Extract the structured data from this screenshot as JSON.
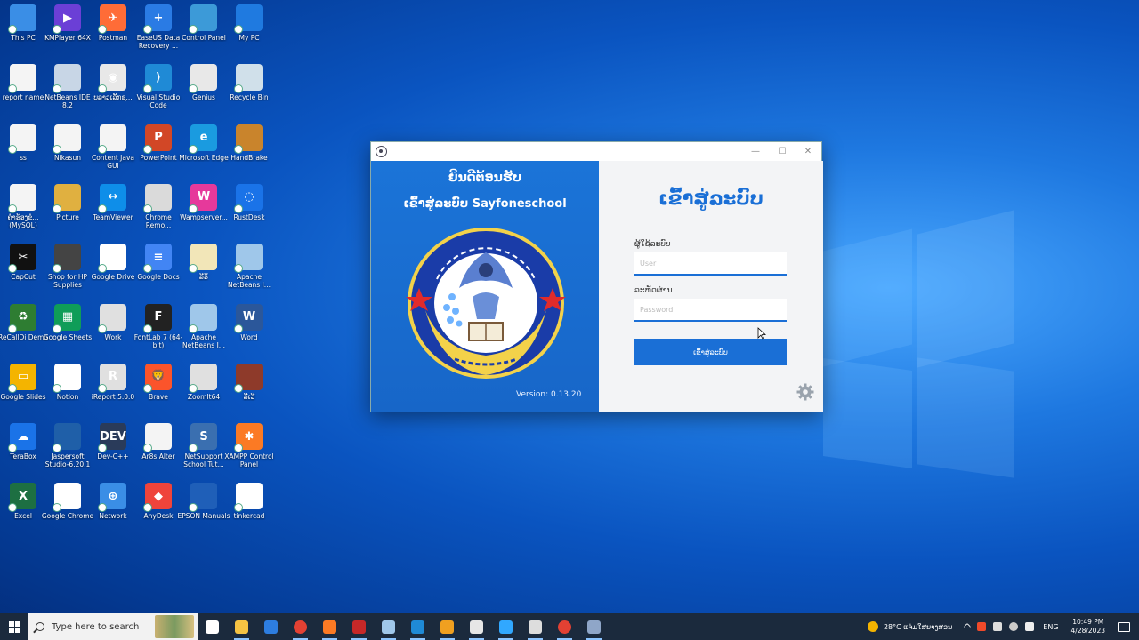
{
  "desktop": {
    "icons": [
      {
        "label": "This PC",
        "color": "#3a8ee6",
        "glyph": ""
      },
      {
        "label": "KMPlayer 64X",
        "color": "#6b3fd6",
        "glyph": "▶"
      },
      {
        "label": "Postman",
        "color": "#ff6c37",
        "glyph": "✈"
      },
      {
        "label": "EaseUS Data Recovery ...",
        "color": "#2a7be4",
        "glyph": "+"
      },
      {
        "label": "Control Panel",
        "color": "#3c9ad8",
        "glyph": ""
      },
      {
        "label": "My PC",
        "color": "#1f7ae0",
        "glyph": ""
      },
      {
        "label": "report name",
        "color": "#f4f4f4",
        "glyph": ""
      },
      {
        "label": "NetBeans IDE 8.2",
        "color": "#c8d6e6",
        "glyph": ""
      },
      {
        "label": "ບລາວເລັກຊ...",
        "color": "#e8e8e8",
        "glyph": "◉"
      },
      {
        "label": "Visual Studio Code",
        "color": "#1f8ad6",
        "glyph": "⟩"
      },
      {
        "label": "Genius",
        "color": "#e8e8e8",
        "glyph": ""
      },
      {
        "label": "Recycle Bin",
        "color": "#d0e0ea",
        "glyph": ""
      },
      {
        "label": "ss",
        "color": "#f4f4f4",
        "glyph": ""
      },
      {
        "label": "Nikasun",
        "color": "#f4f4f4",
        "glyph": ""
      },
      {
        "label": "Content Java GUI",
        "color": "#f4f4f4",
        "glyph": ""
      },
      {
        "label": "PowerPoint",
        "color": "#d24726",
        "glyph": "P"
      },
      {
        "label": "Microsoft Edge",
        "color": "#1a9be0",
        "glyph": "e"
      },
      {
        "label": "HandBrake",
        "color": "#c9842c",
        "glyph": ""
      },
      {
        "label": "ຄຳຮ້ອງຂໍ...(MySQL)",
        "color": "#f4f4f4",
        "glyph": ""
      },
      {
        "label": "Picture",
        "color": "#e0b040",
        "glyph": ""
      },
      {
        "label": "TeamViewer",
        "color": "#0e8ee9",
        "glyph": "↔"
      },
      {
        "label": "Chrome Remo...",
        "color": "#dadada",
        "glyph": ""
      },
      {
        "label": "Wampserver...",
        "color": "#e6399b",
        "glyph": "W"
      },
      {
        "label": "RustDesk",
        "color": "#1a73e8",
        "glyph": "◌"
      },
      {
        "label": "CapCut",
        "color": "#111111",
        "glyph": "✂"
      },
      {
        "label": "Shop for HP Supplies",
        "color": "#444444",
        "glyph": ""
      },
      {
        "label": "Google Drive",
        "color": "#ffffff",
        "glyph": "▲"
      },
      {
        "label": "Google Docs",
        "color": "#4285f4",
        "glyph": "≡"
      },
      {
        "label": "ລີຣິ",
        "color": "#f2e6b8",
        "glyph": ""
      },
      {
        "label": "Apache NetBeans I...",
        "color": "#9fc7ea",
        "glyph": ""
      },
      {
        "label": "ReCallDi Demo",
        "color": "#2e7d32",
        "glyph": "♻"
      },
      {
        "label": "Google Sheets",
        "color": "#0f9d58",
        "glyph": "▦"
      },
      {
        "label": "Work",
        "color": "#e0e0e0",
        "glyph": ""
      },
      {
        "label": "FontLab 7 (64-bit)",
        "color": "#222222",
        "glyph": "F"
      },
      {
        "label": "Apache NetBeans I...",
        "color": "#9fc7ea",
        "glyph": ""
      },
      {
        "label": "Word",
        "color": "#2b579a",
        "glyph": "W"
      },
      {
        "label": "Google Slides",
        "color": "#f4b400",
        "glyph": "▭"
      },
      {
        "label": "Notion",
        "color": "#ffffff",
        "glyph": "N"
      },
      {
        "label": "iReport 5.0.0",
        "color": "#e0e0e0",
        "glyph": "R"
      },
      {
        "label": "Brave",
        "color": "#fb542b",
        "glyph": "🦁"
      },
      {
        "label": "ZoomIt64",
        "color": "#e0e0e0",
        "glyph": ""
      },
      {
        "label": "ລີເວີ",
        "color": "#8e3a2a",
        "glyph": ""
      },
      {
        "label": "TeraBox",
        "color": "#1a73e8",
        "glyph": "☁"
      },
      {
        "label": "Jaspersoft Studio-6.20.1",
        "color": "#1f5fa8",
        "glyph": ""
      },
      {
        "label": "Dev-C++",
        "color": "#2a3b5a",
        "glyph": "DEV"
      },
      {
        "label": "Ar8s Alter",
        "color": "#f4f4f4",
        "glyph": ""
      },
      {
        "label": "NetSupport School Tut...",
        "color": "#3a6fb0",
        "glyph": "S"
      },
      {
        "label": "XAMPP Control Panel",
        "color": "#fb7a24",
        "glyph": "✱"
      },
      {
        "label": "Excel",
        "color": "#1d6f42",
        "glyph": "X"
      },
      {
        "label": "Google Chrome",
        "color": "#ffffff",
        "glyph": "◉"
      },
      {
        "label": "Network",
        "color": "#3a8ee6",
        "glyph": "⊕"
      },
      {
        "label": "AnyDesk",
        "color": "#ef443b",
        "glyph": "◆"
      },
      {
        "label": "EPSON Manuals",
        "color": "#1f5fb8",
        "glyph": ""
      },
      {
        "label": "tinkercad",
        "color": "#ffffff",
        "glyph": ""
      }
    ]
  },
  "window": {
    "left": {
      "welcome": "ຍິນດີຕ້ອນຮັບ",
      "subtitle": "ເຂົ້າສູ່ລະບົບ Sayfoneschool",
      "version": "Version: 0.13.20"
    },
    "right": {
      "title": "ເຂົ້າສູ່ລະບົບ",
      "user_label": "ຜູ້ໃຊ້ລະບົບ",
      "user_placeholder": "User",
      "user_value": "",
      "password_label": "ລະຫັດຜ່ານ",
      "password_placeholder": "Password",
      "password_value": "",
      "login_button": "ເຂົ້າສູ່ລະບົບ"
    },
    "controls": {
      "minimize": "—",
      "maximize": "☐",
      "close": "✕"
    }
  },
  "taskbar": {
    "search_placeholder": "Type here to search",
    "apps": [
      {
        "name": "task-view",
        "color": "#ffffff"
      },
      {
        "name": "file-explorer",
        "color": "#f6c343"
      },
      {
        "name": "store",
        "color": "#2d7de0"
      },
      {
        "name": "chrome",
        "color": "#e34133"
      },
      {
        "name": "xampp",
        "color": "#fb7a24"
      },
      {
        "name": "app-red",
        "color": "#c62828"
      },
      {
        "name": "netbeans",
        "color": "#9fc7ea"
      },
      {
        "name": "vscode-blue",
        "color": "#1f8ad6"
      },
      {
        "name": "app-shield",
        "color": "#f0a020"
      },
      {
        "name": "app-shield-2",
        "color": "#e6e6e6"
      },
      {
        "name": "photoshop",
        "color": "#31a8ff"
      },
      {
        "name": "app-check",
        "color": "#dddddd"
      },
      {
        "name": "chrome-2",
        "color": "#e34133"
      },
      {
        "name": "sayfoneschool",
        "color": "#8fa6c8"
      }
    ],
    "weather": "28°C ແຈ່ມໃສບາງສ່ວນ",
    "language": "ENG",
    "time": "10:49 PM",
    "date": "4/28/2023"
  }
}
